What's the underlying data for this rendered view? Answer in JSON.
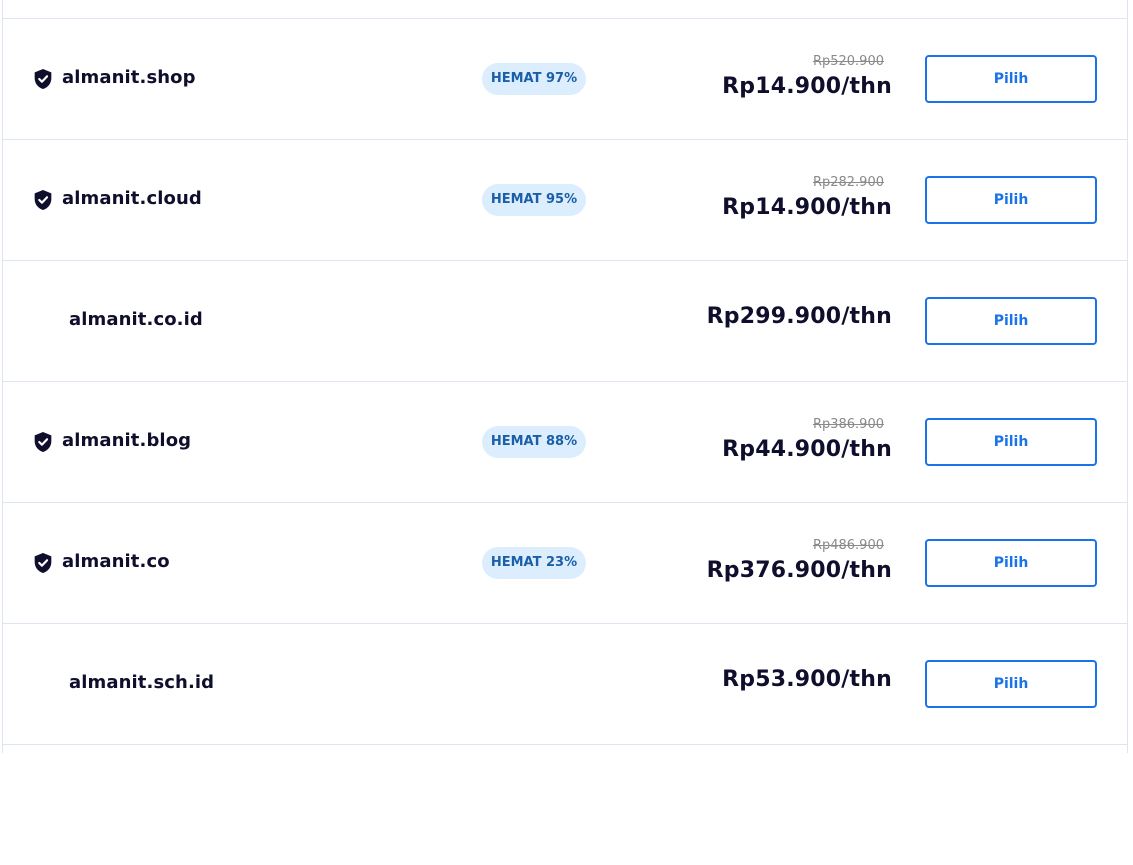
{
  "domains": [
    {
      "name": "almanit.shop",
      "verified": true,
      "badge": "HEMAT 97%",
      "old_price": "Rp520.900",
      "price": "Rp14.900/thn",
      "button": "Pilih"
    },
    {
      "name": "almanit.cloud",
      "verified": true,
      "badge": "HEMAT 95%",
      "old_price": "Rp282.900",
      "price": "Rp14.900/thn",
      "button": "Pilih"
    },
    {
      "name": "almanit.co.id",
      "verified": false,
      "badge": "",
      "old_price": "",
      "price": "Rp299.900/thn",
      "button": "Pilih"
    },
    {
      "name": "almanit.blog",
      "verified": true,
      "badge": "HEMAT 88%",
      "old_price": "Rp386.900",
      "price": "Rp44.900/thn",
      "button": "Pilih"
    },
    {
      "name": "almanit.co",
      "verified": true,
      "badge": "HEMAT 23%",
      "old_price": "Rp486.900",
      "price": "Rp376.900/thn",
      "button": "Pilih"
    },
    {
      "name": "almanit.sch.id",
      "verified": false,
      "badge": "",
      "old_price": "",
      "price": "Rp53.900/thn",
      "button": "Pilih"
    }
  ],
  "colors": {
    "accent": "#1a73e8",
    "badge_bg": "#dceefe",
    "badge_text": "#1b5fa8",
    "text": "#0f0f2d",
    "border": "#dde6f0"
  },
  "icons": {
    "verified": "shield-check-icon"
  }
}
